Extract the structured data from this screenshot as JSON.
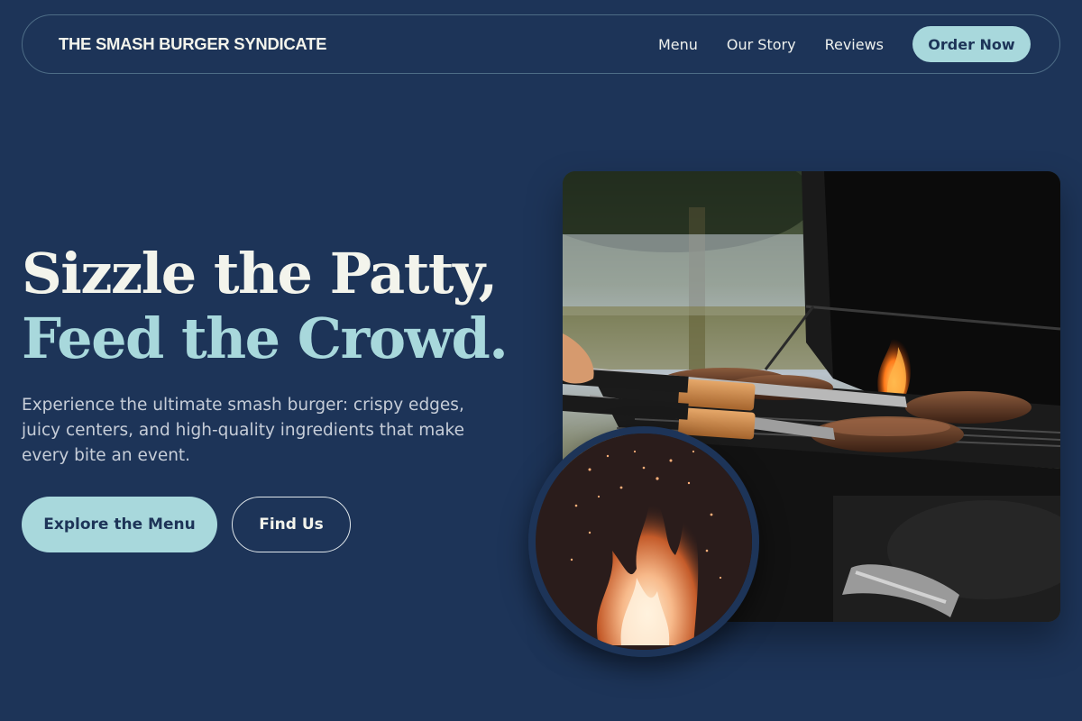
{
  "header": {
    "brand": "THE SMASH BURGER SYNDICATE",
    "nav": [
      {
        "label": "Menu"
      },
      {
        "label": "Our Story"
      },
      {
        "label": "Reviews"
      }
    ],
    "order_label": "Order Now"
  },
  "hero": {
    "title_line1": "Sizzle the Patty,",
    "title_line2": "Feed the Crowd.",
    "description": "Experience the ultimate smash burger: crispy edges, juicy centers, and high-quality ingredients that make every bite an event.",
    "primary_cta": "Explore the Menu",
    "secondary_cta": "Find Us"
  },
  "images": {
    "grill": "grill-photo",
    "fire": "fire-photo"
  },
  "colors": {
    "background": "#1d3458",
    "accent": "#a8d8dc",
    "text": "#f3f4ec"
  }
}
